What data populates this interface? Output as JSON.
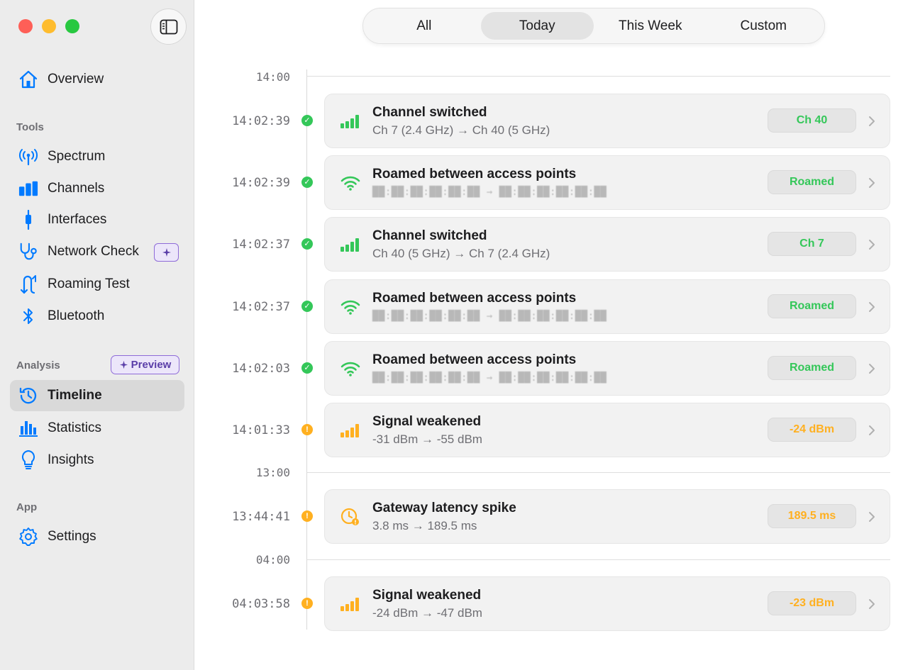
{
  "colors": {
    "accent": "#007aff",
    "green": "#34c759",
    "orange": "#ffb020",
    "purple": "#8e6bd8"
  },
  "sidebar": {
    "items_top": [
      {
        "label": "Overview",
        "icon": "house-icon"
      }
    ],
    "sections": [
      {
        "title": "Tools",
        "items": [
          {
            "label": "Spectrum",
            "icon": "antenna-icon"
          },
          {
            "label": "Channels",
            "icon": "channels-bars-icon"
          },
          {
            "label": "Interfaces",
            "icon": "interface-plug-icon"
          },
          {
            "label": "Network Check",
            "icon": "stethoscope-icon",
            "badge_icon": "sparkle-icon"
          },
          {
            "label": "Roaming Test",
            "icon": "roaming-arrows-icon"
          },
          {
            "label": "Bluetooth",
            "icon": "bluetooth-icon"
          }
        ]
      },
      {
        "title": "Analysis",
        "badge": "Preview",
        "items": [
          {
            "label": "Timeline",
            "icon": "clock-history-icon",
            "selected": true
          },
          {
            "label": "Statistics",
            "icon": "bar-chart-icon"
          },
          {
            "label": "Insights",
            "icon": "lightbulb-icon"
          }
        ]
      },
      {
        "title": "App",
        "items": [
          {
            "label": "Settings",
            "icon": "gear-icon"
          }
        ]
      }
    ]
  },
  "filter": {
    "options": [
      "All",
      "Today",
      "This Week",
      "Custom"
    ],
    "selected": "Today"
  },
  "timeline": {
    "hours": [
      "14:00",
      "13:00",
      "04:00"
    ],
    "events": [
      {
        "time": "14:02:39",
        "status": "ok",
        "icon": "signal-bars-icon",
        "title": "Channel switched",
        "detail": "Ch 7 (2.4 GHz) → Ch 40 (5 GHz)",
        "tag": "Ch 40",
        "tag_color": "green"
      },
      {
        "time": "14:02:39",
        "status": "ok",
        "icon": "wifi-icon",
        "title": "Roamed between access points",
        "detail": "██:██:██:██:██:██ → ██:██:██:██:██:██",
        "tag": "Roamed",
        "tag_color": "green"
      },
      {
        "time": "14:02:37",
        "status": "ok",
        "icon": "signal-bars-icon",
        "title": "Channel switched",
        "detail": "Ch 40 (5 GHz) → Ch 7 (2.4 GHz)",
        "tag": "Ch 7",
        "tag_color": "green"
      },
      {
        "time": "14:02:37",
        "status": "ok",
        "icon": "wifi-icon",
        "title": "Roamed between access points",
        "detail": "██:██:██:██:██:██ → ██:██:██:██:██:██",
        "tag": "Roamed",
        "tag_color": "green"
      },
      {
        "time": "14:02:03",
        "status": "ok",
        "icon": "wifi-icon",
        "title": "Roamed between access points",
        "detail": "██:██:██:██:██:██ → ██:██:██:██:██:██",
        "tag": "Roamed",
        "tag_color": "green"
      },
      {
        "time": "14:01:33",
        "status": "warn",
        "icon": "signal-bars-icon",
        "title": "Signal weakened",
        "detail": "-31 dBm → -55 dBm",
        "tag": "-24 dBm",
        "tag_color": "orange"
      },
      {
        "time": "13:44:41",
        "status": "warn",
        "icon": "latency-clock-icon",
        "title": "Gateway latency spike",
        "detail": "3.8 ms → 189.5 ms",
        "tag": "189.5 ms",
        "tag_color": "orange"
      },
      {
        "time": "04:03:58",
        "status": "warn",
        "icon": "signal-bars-icon",
        "title": "Signal weakened",
        "detail": "-24 dBm → -47 dBm",
        "tag": "-23 dBm",
        "tag_color": "orange"
      }
    ]
  }
}
